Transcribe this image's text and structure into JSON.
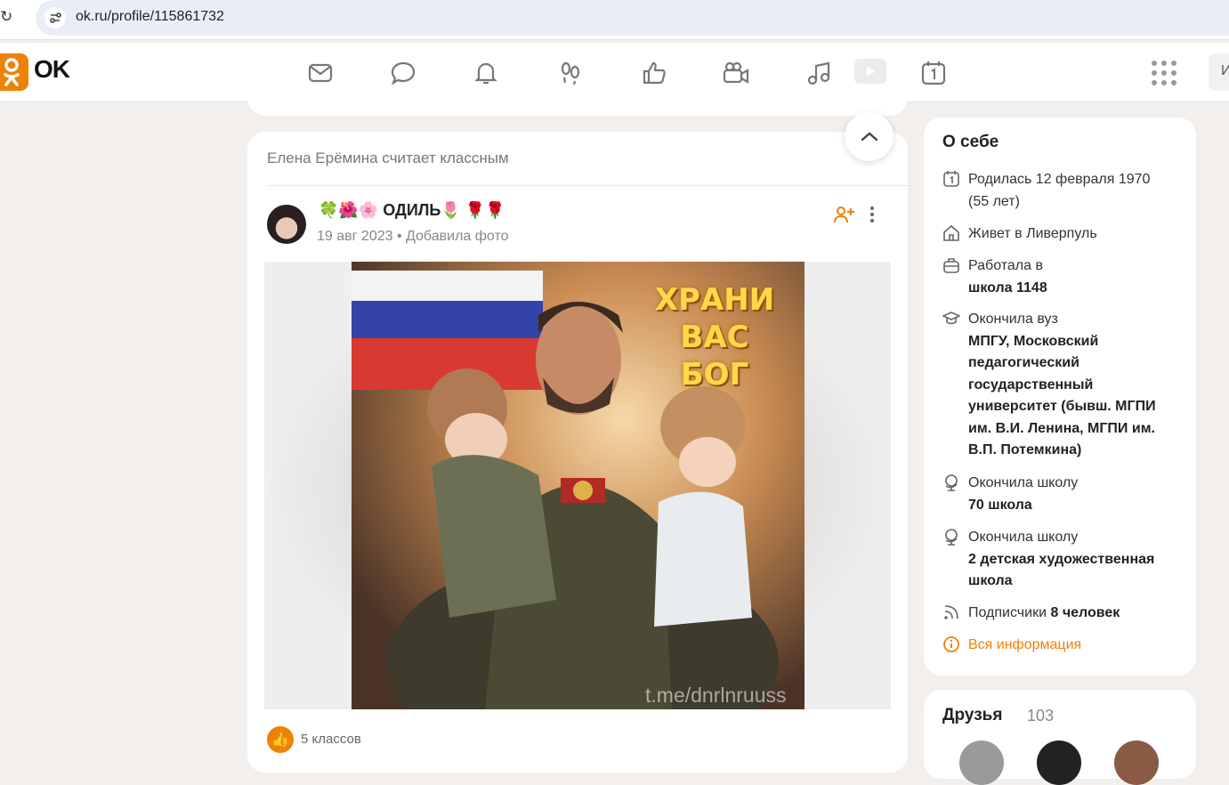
{
  "browser": {
    "url": "ok.ru/profile/115861732"
  },
  "header": {
    "logo_text": "OK",
    "search_stub": "И",
    "nav_icons": [
      "mail-icon",
      "chat-icon",
      "bell-icon",
      "footprints-icon",
      "like-icon",
      "video-camera-icon",
      "music-icon",
      "video-icon",
      "calendar-icon"
    ]
  },
  "feed": {
    "liked_by": "Елена Ерёмина считает классным",
    "author": "🍀🌺🌸 ОДИЛЬ🌷 🌹🌹",
    "date": "19 авг 2023",
    "meta_separator": " • ",
    "action": "Добавила фото",
    "photo_caption_line1": "ХРАНИ ВАС",
    "photo_caption_line2": "БОГ",
    "watermark": "t.me/dnrlnruuss",
    "likes": "5 классов"
  },
  "about": {
    "title": "О себе",
    "born": "Родилась 12 февраля 1970 (55 лет)",
    "lives": "Живет в Ливерпуль",
    "worked_label": "Работала в",
    "worked_value": "школа 1148",
    "uni_label": "Окончила вуз",
    "uni_value": "МПГУ, Московский педагогический государственный университет (бывш. МГПИ им. В.И. Ленина, МГПИ им. В.П. Потемкина)",
    "school1_label": "Окончила школу",
    "school1_value": "70 школа",
    "school2_label": "Окончила школу",
    "school2_value": "2 детская художественная школа",
    "subscribers_label": "Подписчики",
    "subscribers_value": "8 человек",
    "all_info": "Вся информация"
  },
  "friends": {
    "title": "Друзья",
    "count": "103"
  },
  "colors": {
    "accent": "#ee8208",
    "background": "#f2efec"
  }
}
